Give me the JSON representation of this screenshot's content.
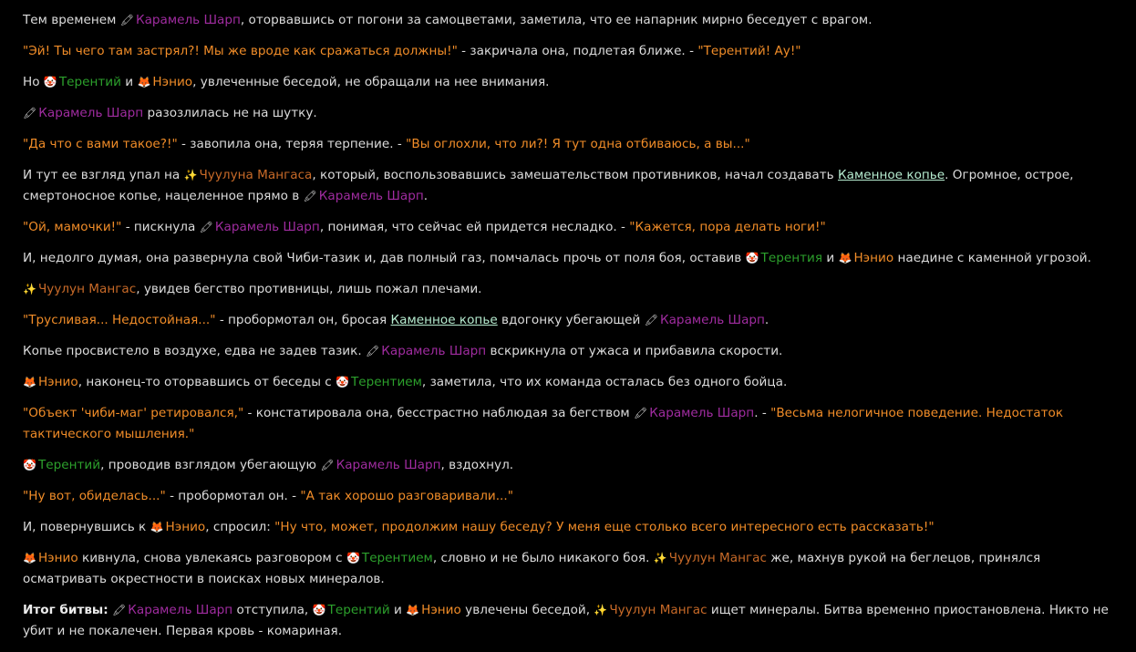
{
  "colors": {
    "background": "#000000",
    "narration": "#dcdcdc",
    "quote": "#f08c28",
    "caramel_sharp": "#a02ca0",
    "terenty": "#2ca02c",
    "neo": "#f08c28",
    "chuulun_mangas": "#c86a28",
    "link": "#b6ecd0"
  },
  "icons": {
    "caramel_sharp": "🖍",
    "terenty": "🤡",
    "neo": "🦊",
    "chuulun_mangas": "✨"
  },
  "paragraphs": [
    {
      "spans": [
        {
          "t": "narr",
          "v": "Тем временем "
        },
        {
          "t": "ic",
          "v": "🖍",
          "n": "crayon-icon"
        },
        {
          "t": "caramel",
          "v": "Карамель Шарп"
        },
        {
          "t": "narr",
          "v": ", оторвавшись от погони за самоцветами, заметила, что ее напарник мирно беседует с врагом."
        }
      ]
    },
    {
      "spans": [
        {
          "t": "quote",
          "v": "\"Эй! Ты чего там застрял?! Мы же вроде как сражаться должны!\""
        },
        {
          "t": "narr",
          "v": " - закричала она, подлетая ближе. - "
        },
        {
          "t": "quote",
          "v": "\"Терентий! Ау!\""
        }
      ]
    },
    {
      "spans": [
        {
          "t": "narr",
          "v": "Но "
        },
        {
          "t": "ic",
          "v": "🤡",
          "n": "clown-icon"
        },
        {
          "t": "ter",
          "v": "Терентий"
        },
        {
          "t": "narr",
          "v": " и "
        },
        {
          "t": "ic",
          "v": "🦊",
          "n": "fox-icon"
        },
        {
          "t": "neo",
          "v": "Нэнио"
        },
        {
          "t": "narr",
          "v": ", увлеченные беседой, не обращали на нее внимания."
        }
      ]
    },
    {
      "spans": [
        {
          "t": "ic",
          "v": "🖍",
          "n": "crayon-icon"
        },
        {
          "t": "caramel",
          "v": "Карамель Шарп"
        },
        {
          "t": "narr",
          "v": " разозлилась не на шутку."
        }
      ]
    },
    {
      "spans": [
        {
          "t": "quote",
          "v": "\"Да что с вами такое?!\""
        },
        {
          "t": "narr",
          "v": " - завопила она, теряя терпение. - "
        },
        {
          "t": "quote",
          "v": "\"Вы оглохли, что ли?! Я тут одна отбиваюсь, а вы...\""
        }
      ]
    },
    {
      "spans": [
        {
          "t": "narr",
          "v": "И тут ее взгляд упал на "
        },
        {
          "t": "ic",
          "v": "✨",
          "n": "sparkles-icon"
        },
        {
          "t": "chuu",
          "v": "Чуулуна Мангаса"
        },
        {
          "t": "narr",
          "v": ", который, воспользовавшись замешательством противников, начал создавать "
        },
        {
          "t": "link",
          "v": "Каменное копье"
        },
        {
          "t": "narr",
          "v": ". Огромное, острое, смертоносное копье, нацеленное прямо в "
        },
        {
          "t": "ic",
          "v": "🖍",
          "n": "crayon-icon"
        },
        {
          "t": "caramel",
          "v": "Карамель Шарп"
        },
        {
          "t": "narr",
          "v": "."
        }
      ]
    },
    {
      "spans": [
        {
          "t": "quote",
          "v": "\"Ой, мамочки!\""
        },
        {
          "t": "narr",
          "v": " - пискнула "
        },
        {
          "t": "ic",
          "v": "🖍",
          "n": "crayon-icon"
        },
        {
          "t": "caramel",
          "v": "Карамель Шарп"
        },
        {
          "t": "narr",
          "v": ", понимая, что сейчас ей придется несладко. - "
        },
        {
          "t": "quote",
          "v": "\"Кажется, пора делать ноги!\""
        }
      ]
    },
    {
      "spans": [
        {
          "t": "narr",
          "v": "И, недолго думая, она развернула свой Чиби-тазик и, дав полный газ, помчалась прочь от поля боя, оставив "
        },
        {
          "t": "ic",
          "v": "🤡",
          "n": "clown-icon"
        },
        {
          "t": "ter",
          "v": "Терентия"
        },
        {
          "t": "narr",
          "v": " и "
        },
        {
          "t": "ic",
          "v": "🦊",
          "n": "fox-icon"
        },
        {
          "t": "neo",
          "v": "Нэнио"
        },
        {
          "t": "narr",
          "v": " наедине с каменной угрозой."
        }
      ]
    },
    {
      "spans": [
        {
          "t": "ic",
          "v": "✨",
          "n": "sparkles-icon"
        },
        {
          "t": "chuu",
          "v": "Чуулун Мангас"
        },
        {
          "t": "narr",
          "v": ", увидев бегство противницы, лишь пожал плечами."
        }
      ]
    },
    {
      "spans": [
        {
          "t": "quote",
          "v": "\"Трусливая... Недостойная...\""
        },
        {
          "t": "narr",
          "v": " - пробормотал он, бросая "
        },
        {
          "t": "link",
          "v": "Каменное копье"
        },
        {
          "t": "narr",
          "v": " вдогонку убегающей "
        },
        {
          "t": "ic",
          "v": "🖍",
          "n": "crayon-icon"
        },
        {
          "t": "caramel",
          "v": "Карамель Шарп"
        },
        {
          "t": "narr",
          "v": "."
        }
      ]
    },
    {
      "spans": [
        {
          "t": "narr",
          "v": "Копье просвистело в воздухе, едва не задев тазик. "
        },
        {
          "t": "ic",
          "v": "🖍",
          "n": "crayon-icon"
        },
        {
          "t": "caramel",
          "v": "Карамель Шарп"
        },
        {
          "t": "narr",
          "v": " вскрикнула от ужаса и прибавила скорости."
        }
      ]
    },
    {
      "spans": [
        {
          "t": "ic",
          "v": "🦊",
          "n": "fox-icon"
        },
        {
          "t": "neo",
          "v": "Нэнио"
        },
        {
          "t": "narr",
          "v": ", наконец-то оторвавшись от беседы с "
        },
        {
          "t": "ic",
          "v": "🤡",
          "n": "clown-icon"
        },
        {
          "t": "ter",
          "v": "Терентием"
        },
        {
          "t": "narr",
          "v": ", заметила, что их команда осталась без одного бойца."
        }
      ]
    },
    {
      "spans": [
        {
          "t": "quote",
          "v": "\"Объект 'чиби-маг' ретировался,\""
        },
        {
          "t": "narr",
          "v": " - констатировала она, бесстрастно наблюдая за бегством "
        },
        {
          "t": "ic",
          "v": "🖍",
          "n": "crayon-icon"
        },
        {
          "t": "caramel",
          "v": "Карамель Шарп"
        },
        {
          "t": "narr",
          "v": ". - "
        },
        {
          "t": "quote",
          "v": "\"Весьма нелогичное поведение. Недостаток тактического мышления.\""
        }
      ]
    },
    {
      "spans": [
        {
          "t": "ic",
          "v": "🤡",
          "n": "clown-icon"
        },
        {
          "t": "ter",
          "v": "Терентий"
        },
        {
          "t": "narr",
          "v": ", проводив взглядом убегающую "
        },
        {
          "t": "ic",
          "v": "🖍",
          "n": "crayon-icon"
        },
        {
          "t": "caramel",
          "v": "Карамель Шарп"
        },
        {
          "t": "narr",
          "v": ", вздохнул."
        }
      ]
    },
    {
      "spans": [
        {
          "t": "quote",
          "v": "\"Ну вот, обиделась...\""
        },
        {
          "t": "narr",
          "v": " - пробормотал он. - "
        },
        {
          "t": "quote",
          "v": "\"А так хорошо разговаривали...\""
        }
      ]
    },
    {
      "spans": [
        {
          "t": "narr",
          "v": "И, повернувшись к "
        },
        {
          "t": "ic",
          "v": "🦊",
          "n": "fox-icon"
        },
        {
          "t": "neo",
          "v": "Нэнио"
        },
        {
          "t": "narr",
          "v": ", спросил: "
        },
        {
          "t": "quote",
          "v": "\"Ну что, может, продолжим нашу беседу? У меня еще столько всего интересного есть рассказать!\""
        }
      ]
    },
    {
      "spans": [
        {
          "t": "ic",
          "v": "🦊",
          "n": "fox-icon"
        },
        {
          "t": "neo",
          "v": "Нэнио"
        },
        {
          "t": "narr",
          "v": " кивнула, снова увлекаясь разговором с "
        },
        {
          "t": "ic",
          "v": "🤡",
          "n": "clown-icon"
        },
        {
          "t": "ter",
          "v": "Терентием"
        },
        {
          "t": "narr",
          "v": ", словно и не было никакого боя. "
        },
        {
          "t": "ic",
          "v": "✨",
          "n": "sparkles-icon"
        },
        {
          "t": "chuu",
          "v": "Чуулун Мангас"
        },
        {
          "t": "narr",
          "v": " же, махнув рукой на беглецов, принялся осматривать окрестности в поисках новых минералов."
        }
      ]
    },
    {
      "spans": [
        {
          "t": "bold",
          "v": "Итог битвы:"
        },
        {
          "t": "narr",
          "v": " "
        },
        {
          "t": "ic",
          "v": "🖍",
          "n": "crayon-icon"
        },
        {
          "t": "caramel",
          "v": "Карамель Шарп"
        },
        {
          "t": "narr",
          "v": " отступила, "
        },
        {
          "t": "ic",
          "v": "🤡",
          "n": "clown-icon"
        },
        {
          "t": "ter",
          "v": "Терентий"
        },
        {
          "t": "narr",
          "v": " и "
        },
        {
          "t": "ic",
          "v": "🦊",
          "n": "fox-icon"
        },
        {
          "t": "neo",
          "v": "Нэнио"
        },
        {
          "t": "narr",
          "v": " увлечены беседой, "
        },
        {
          "t": "ic",
          "v": "✨",
          "n": "sparkles-icon"
        },
        {
          "t": "chuu",
          "v": "Чуулун Мангас"
        },
        {
          "t": "narr",
          "v": " ищет минералы. Битва временно приостановлена. Никто не убит и не покалечен. Первая кровь - комариная."
        }
      ]
    }
  ]
}
